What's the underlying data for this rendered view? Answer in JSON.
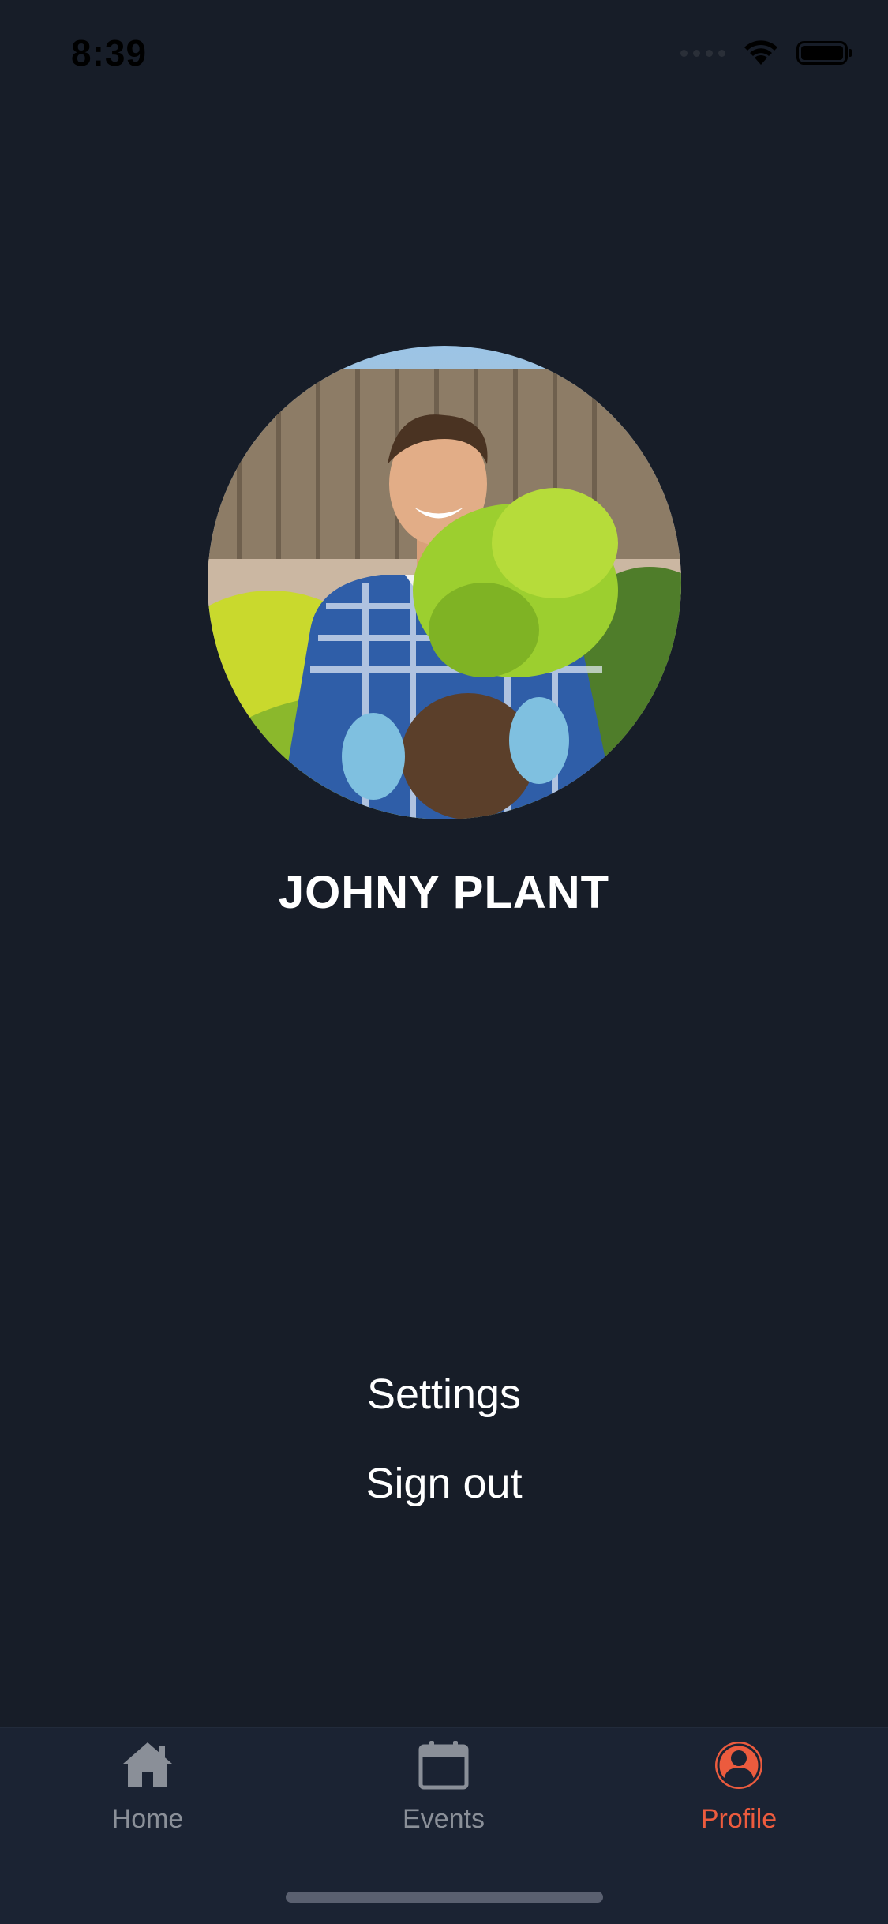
{
  "status_bar": {
    "time": "8:39"
  },
  "profile": {
    "name": "JOHNY PLANT",
    "avatar_icon": "profile-photo-gardener"
  },
  "menu": {
    "settings_label": "Settings",
    "signout_label": "Sign out"
  },
  "tabs": [
    {
      "label": "Home",
      "icon": "home-icon",
      "active": false
    },
    {
      "label": "Events",
      "icon": "calendar-icon",
      "active": false
    },
    {
      "label": "Profile",
      "icon": "user-circle-icon",
      "active": true
    }
  ],
  "colors": {
    "background": "#171d28",
    "tab_bar": "#1b2333",
    "accent": "#ec5b3e",
    "inactive": "#8a8f98"
  }
}
